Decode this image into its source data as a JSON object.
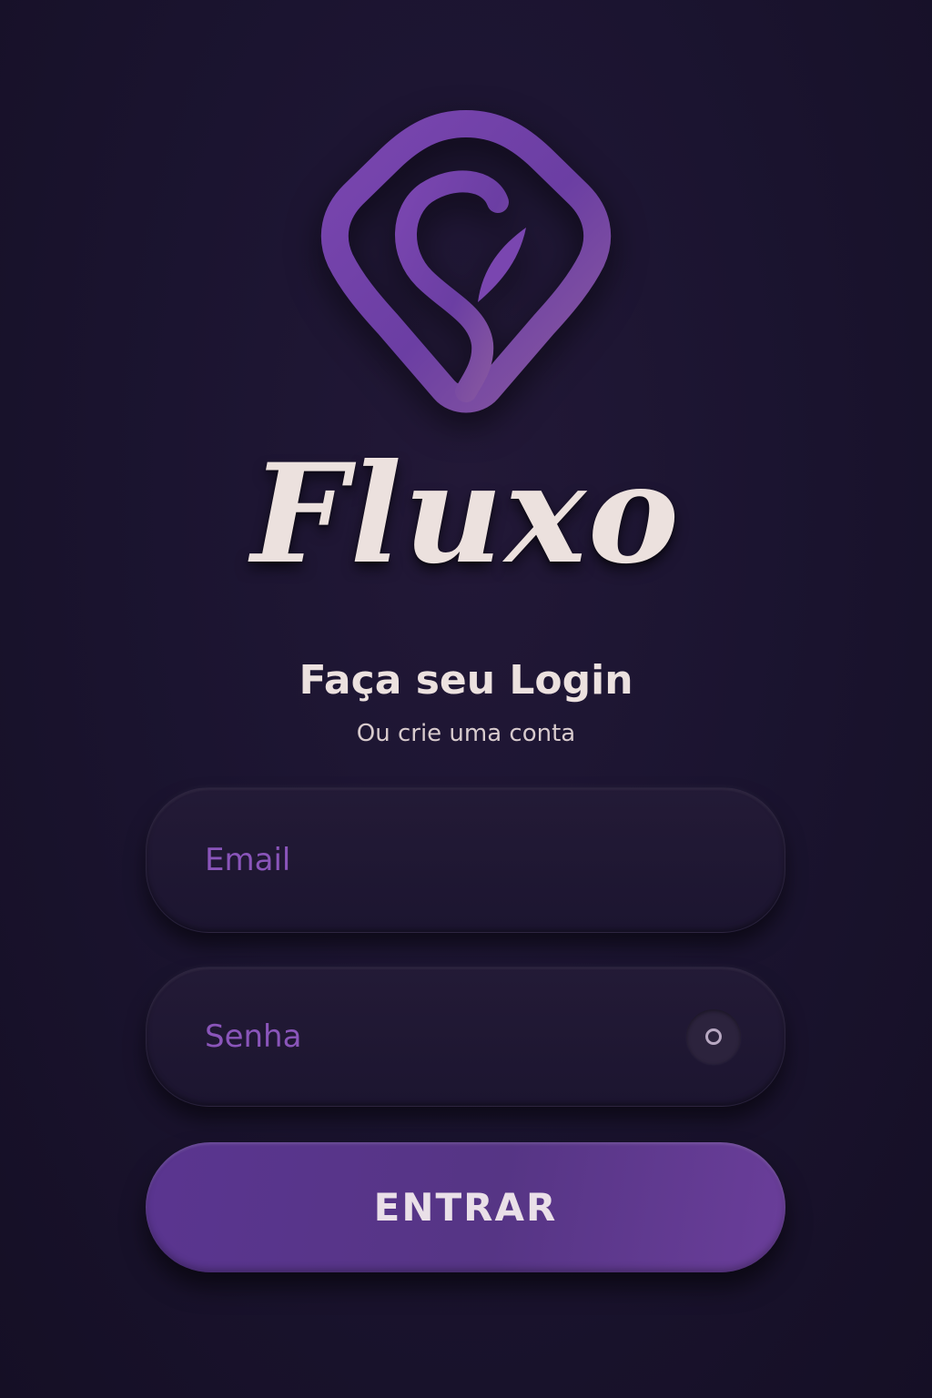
{
  "app": {
    "logo_icon": "fluxo-logo-icon",
    "wordmark": "Fluxo"
  },
  "login": {
    "title": "Faça seu Login",
    "subtitle": "Ou crie uma conta",
    "email": {
      "value": "",
      "placeholder": "Email"
    },
    "password": {
      "value": "",
      "placeholder": "Senha",
      "toggle_icon": "eye-toggle-icon"
    },
    "submit_label": "ENTRAR"
  },
  "colors": {
    "background": "#1b1430",
    "accent": "#6a3e9a",
    "placeholder": "#8a55ba",
    "text": "#ece1de"
  }
}
